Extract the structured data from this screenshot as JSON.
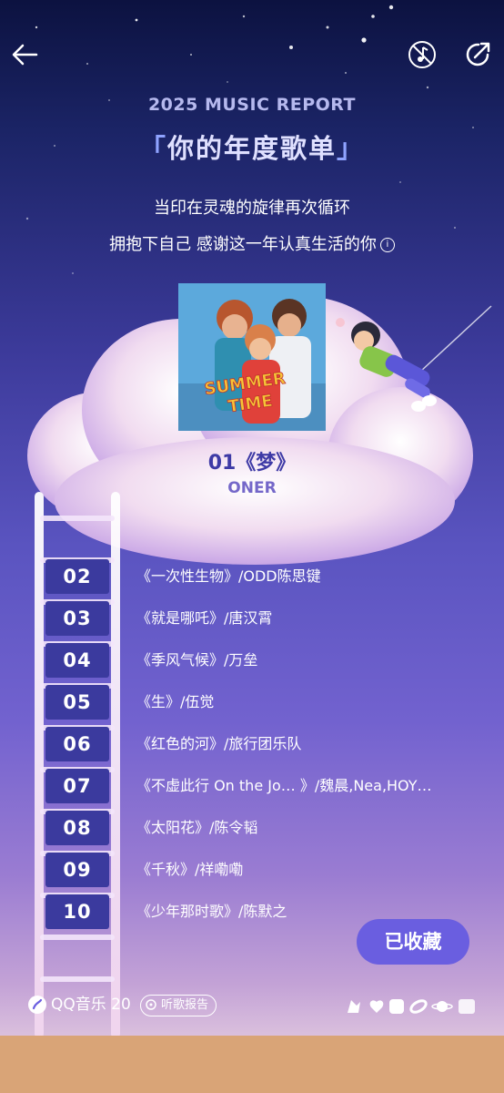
{
  "header": {
    "report_title": "2025 MUSIC REPORT",
    "bracket_left": "「",
    "headline": "你的年度歌单",
    "bracket_right": "」",
    "subtitle_line1": "当印在灵魂的旋律再次循环",
    "subtitle_line2": "拥抱下自己 感谢这一年认真生活的你",
    "info_icon_text": "i"
  },
  "top_song": {
    "title": "01《梦》",
    "artist": "ONER"
  },
  "album_art": {
    "cover_text_line1": "SUMMER",
    "cover_text_line2": "TIME"
  },
  "ranking": [
    {
      "rank": "02",
      "song": "《一次性生物》/ODD陈思键"
    },
    {
      "rank": "03",
      "song": "《就是哪吒》/唐汉霄"
    },
    {
      "rank": "04",
      "song": "《季风气候》/万垒"
    },
    {
      "rank": "05",
      "song": "《生》/伍觉"
    },
    {
      "rank": "06",
      "song": "《红色的河》/旅行团乐队"
    },
    {
      "rank": "07",
      "song": "《不虚此行 On the Jo… 》/魏晨,Nea,HOY…"
    },
    {
      "rank": "08",
      "song": "《太阳花》/陈令韬"
    },
    {
      "rank": "09",
      "song": "《千秋》/祥嘞嘞"
    },
    {
      "rank": "10",
      "song": "《少年那时歌》/陈默之"
    }
  ],
  "actions": {
    "saved_label": "已收藏"
  },
  "footer": {
    "brand": "QQ音乐 20",
    "report_pill": "听歌报告"
  },
  "icons": {
    "back": "arrow-left-icon",
    "music": "music-note-icon",
    "share": "share-icon"
  },
  "colors": {
    "badge_bg": "#3b3a9e",
    "saved_button": "#6a5ee0",
    "bottom_band": "#d9a477",
    "headline": "#dfe0ff"
  }
}
